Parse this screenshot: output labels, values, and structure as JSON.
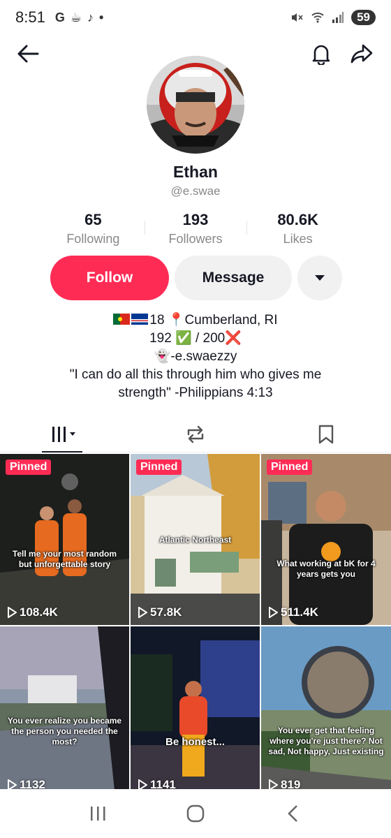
{
  "status": {
    "time": "8:51",
    "apps": "G",
    "battery": "59"
  },
  "profile": {
    "name": "Ethan",
    "handle": "@e.swae"
  },
  "stats": [
    {
      "value": "65",
      "label": "Following"
    },
    {
      "value": "193",
      "label": "Followers"
    },
    {
      "value": "80.6K",
      "label": "Likes"
    }
  ],
  "actions": {
    "follow": "Follow",
    "message": "Message"
  },
  "bio": {
    "line1": "18 📍Cumberland, RI",
    "line2": "192 ✅ / 200❌",
    "line3": "👻-e.swaezzy",
    "line4": "\"I can do all this through him who gives me",
    "line5": "strength\" -Philippians 4:13"
  },
  "videos": [
    {
      "pinned": "Pinned",
      "caption": "Tell me your most random but unforgettable story",
      "views": "108.4K",
      "bg": "#2a2a26"
    },
    {
      "pinned": "Pinned",
      "caption": "Atlantic Northeast",
      "views": "57.8K",
      "bg": "#c4a870"
    },
    {
      "pinned": "Pinned",
      "caption": "What working at bK for 4 years gets you",
      "views": "511.4K",
      "bg": "#6e5a4a"
    },
    {
      "pinned": "",
      "caption": "You ever realize you became the person you needed the most?",
      "views": "1132",
      "bg": "#6c7a8c"
    },
    {
      "pinned": "",
      "caption": "Be honest...",
      "views": "1141",
      "bg": "#1e2a55"
    },
    {
      "pinned": "",
      "caption": "You ever get that feeling where you're just there? Not sad, Not happy, Just existing",
      "views": "819",
      "bg": "#4f6e8a"
    }
  ],
  "colors": {
    "accent": "#fe2c55",
    "secondary_btn": "#f1f1f2"
  }
}
